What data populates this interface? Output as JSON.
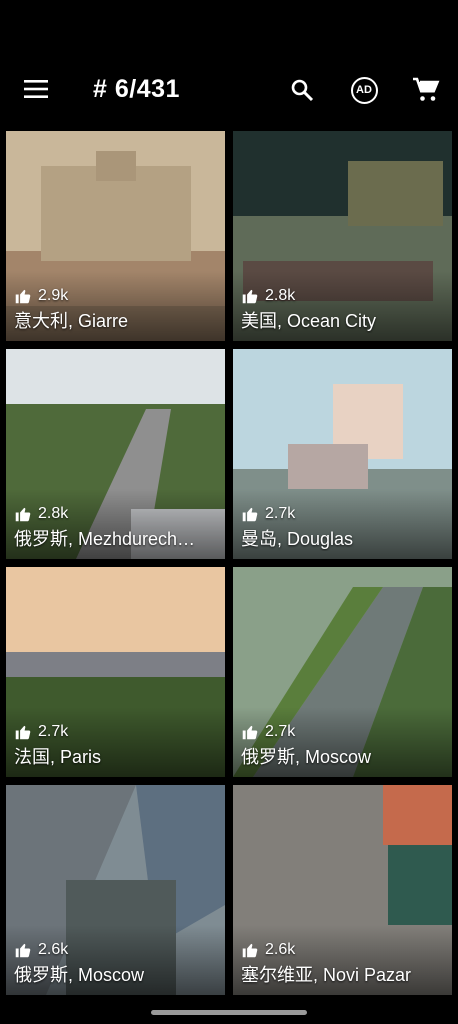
{
  "appbar": {
    "title": "# 6/431",
    "menu_icon": "menu-icon",
    "search_icon": "search-icon",
    "ad_icon": "ad-icon",
    "ad_label": "AD",
    "cart_icon": "cart-icon"
  },
  "tiles": [
    {
      "likes": "2.9k",
      "place": "意大利, Giarre",
      "sky": "#c9b79a",
      "ground": "#a3856a"
    },
    {
      "likes": "2.8k",
      "place": "美国, Ocean City",
      "sky": "#20302e",
      "ground": "#5f6b58"
    },
    {
      "likes": "2.8k",
      "place": "俄罗斯, Mezhdurech…",
      "sky": "#dde3e6",
      "ground": "#4f6a3a"
    },
    {
      "likes": "2.7k",
      "place": "曼岛, Douglas",
      "sky": "#bcd6df",
      "ground": "#7f8f8a"
    },
    {
      "likes": "2.7k",
      "place": "法国, Paris",
      "sky": "#e9c6a1",
      "ground": "#3f5a2d"
    },
    {
      "likes": "2.7k",
      "place": "俄罗斯, Moscow",
      "sky": "#8aa089",
      "ground": "#4b6b3a"
    },
    {
      "likes": "2.6k",
      "place": "俄罗斯, Moscow",
      "sky": "#7f8c93",
      "ground": "#505a5a"
    },
    {
      "likes": "2.6k",
      "place": "塞尔维亚, Novi Pazar",
      "sky": "#8c8a85",
      "ground": "#6f6a66"
    }
  ]
}
